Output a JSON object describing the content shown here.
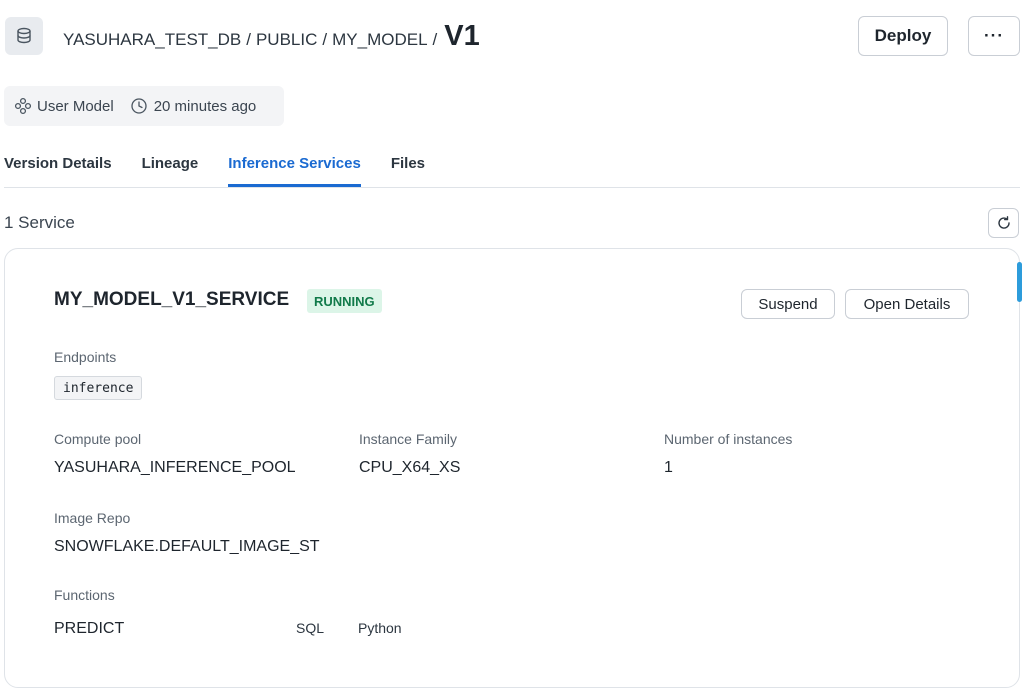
{
  "breadcrumb": {
    "database": "YASUHARA_TEST_DB",
    "schema": "PUBLIC",
    "model": "MY_MODEL",
    "separator": "/",
    "version": "V1"
  },
  "header": {
    "deploy_label": "Deploy",
    "more_label": "···"
  },
  "meta": {
    "model_type": "User Model",
    "updated": "20 minutes ago"
  },
  "tabs": [
    {
      "label": "Version Details",
      "active": false
    },
    {
      "label": "Lineage",
      "active": false
    },
    {
      "label": "Inference Services",
      "active": true
    },
    {
      "label": "Files",
      "active": false
    }
  ],
  "services": {
    "count_label": "1 Service",
    "card": {
      "name": "MY_MODEL_V1_SERVICE",
      "status": "RUNNING",
      "suspend_label": "Suspend",
      "open_details_label": "Open Details",
      "endpoints_label": "Endpoints",
      "endpoint": "inference",
      "compute_pool_label": "Compute pool",
      "compute_pool": "YASUHARA_INFERENCE_POOL",
      "instance_family_label": "Instance Family",
      "instance_family": "CPU_X64_XS",
      "instances_label": "Number of instances",
      "instances": "1",
      "image_repo_label": "Image Repo",
      "image_repo": "SNOWFLAKE.DEFAULT_IMAGE_ST",
      "functions_label": "Functions",
      "function_name": "PREDICT",
      "function_sql": "SQL",
      "function_python": "Python"
    }
  },
  "colors": {
    "accent": "#1a6ad1",
    "status_bg": "#dcf5e8",
    "status_text": "#117a4a"
  },
  "icons": [
    "database-icon",
    "model-icon",
    "clock-icon",
    "refresh-icon"
  ]
}
